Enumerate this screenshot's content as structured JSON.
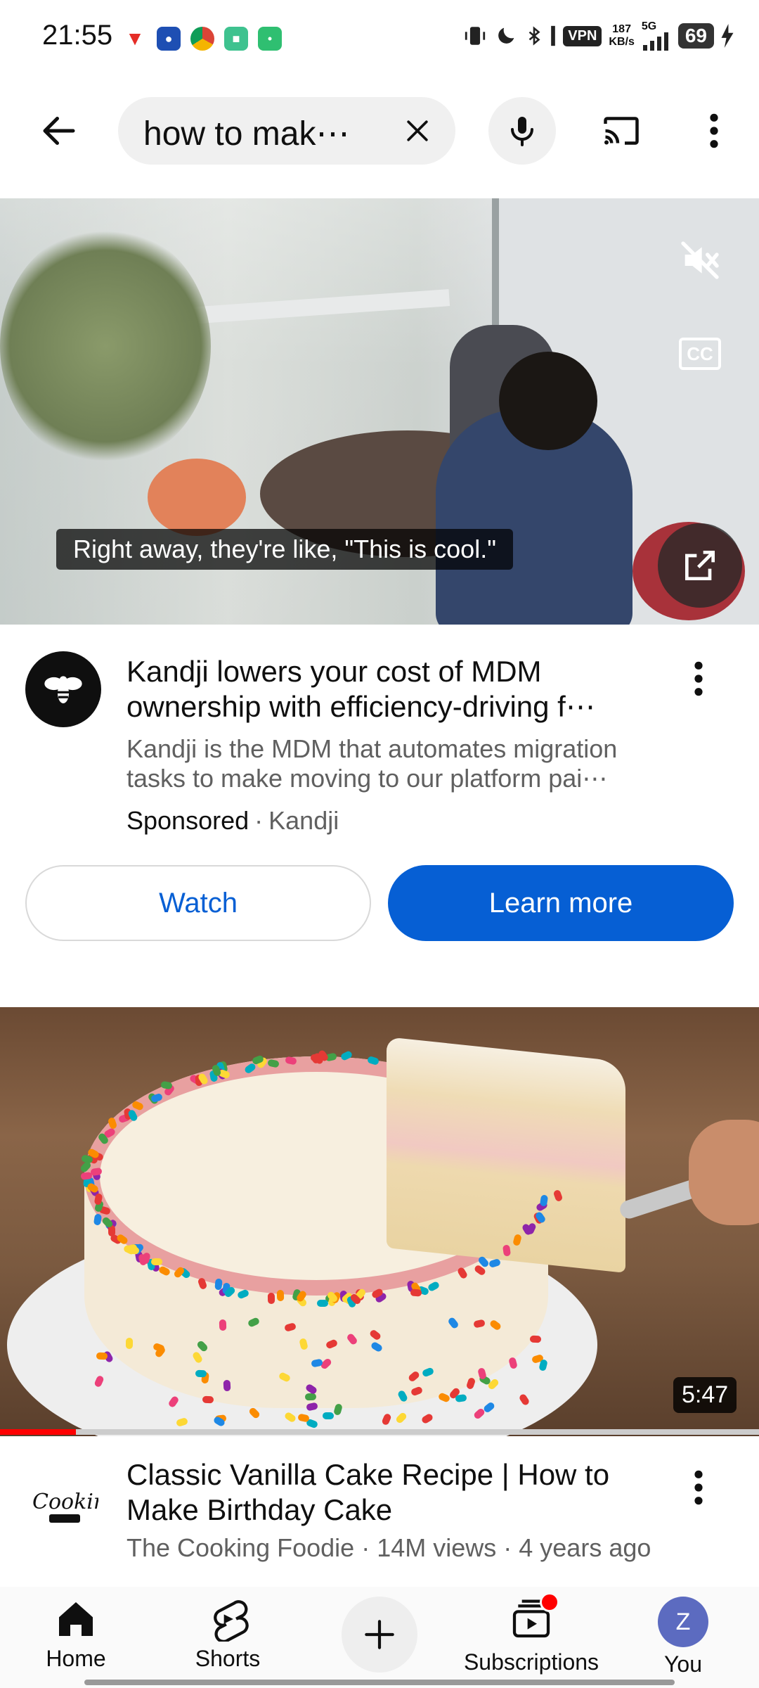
{
  "status_bar": {
    "time": "21:55",
    "vpn": "VPN",
    "speed_value": "187",
    "speed_unit": "KB/s",
    "network": "5G",
    "battery": "69"
  },
  "search": {
    "query": "how to mak⋯"
  },
  "ad": {
    "caption": "Right away, they're like, \"This is cool.\"",
    "cc_label": "CC",
    "title": "Kandji lowers your cost of MDM ownership with efficiency-driving f⋯",
    "description": "Kandji is the MDM that automates migration tasks to make moving to our platform pai⋯",
    "sponsored_label": "Sponsored",
    "advertiser": "Kandji",
    "watch_label": "Watch",
    "learn_more_label": "Learn more"
  },
  "video": {
    "duration": "5:47",
    "progress": 0.1,
    "title": "Classic Vanilla Cake Recipe | How to Make Birthday Cake",
    "channel": "The Cooking Foodie",
    "views": "14M views",
    "age": "4 years ago",
    "channel_logo_text": "Cooking"
  },
  "nav": {
    "home": "Home",
    "shorts": "Shorts",
    "subscriptions": "Subscriptions",
    "you": "You",
    "you_initial": "Z"
  },
  "colors": {
    "accent_blue": "#065fd4",
    "progress_red": "#ff0000",
    "avatar_purple": "#5c6bc0"
  }
}
